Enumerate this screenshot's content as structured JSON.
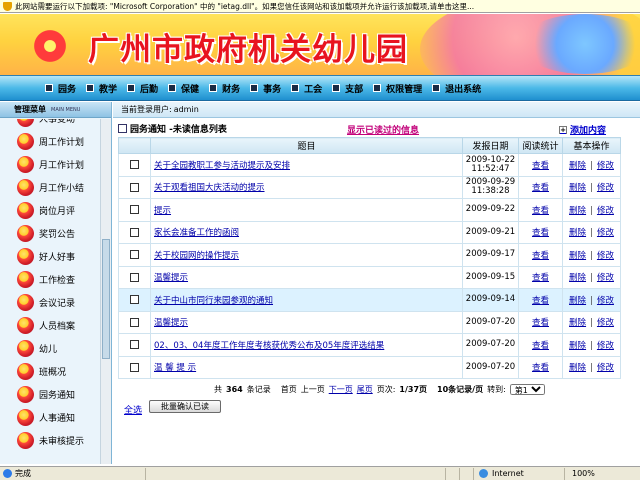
{
  "infobar": {
    "text": "此网站需要运行以下加载项: \"Microsoft Corporation\" 中的 \"ietag.dll\"。如果您信任该网站和该加载项并允许运行该加载项,请单击这里..."
  },
  "banner": {
    "title": "广州市政府机关幼儿园"
  },
  "nav": {
    "items": [
      {
        "label": "园务"
      },
      {
        "label": "教学"
      },
      {
        "label": "后勤"
      },
      {
        "label": "保健"
      },
      {
        "label": "财务"
      },
      {
        "label": "事务"
      },
      {
        "label": "工会"
      },
      {
        "label": "支部"
      },
      {
        "label": "权限管理"
      },
      {
        "label": "退出系统"
      }
    ]
  },
  "sidebar": {
    "heading": "管理菜单",
    "heading_en": "MAIN MENU",
    "items": [
      {
        "label": "人事变动"
      },
      {
        "label": "周工作计划"
      },
      {
        "label": "月工作计划"
      },
      {
        "label": "月工作小结"
      },
      {
        "label": "岗位月评"
      },
      {
        "label": "奖罚公告"
      },
      {
        "label": "好人好事"
      },
      {
        "label": "工作检查"
      },
      {
        "label": "会议记录"
      },
      {
        "label": "人员档案"
      },
      {
        "label": "幼儿"
      },
      {
        "label": "班概况"
      },
      {
        "label": "园务通知"
      },
      {
        "label": "人事通知"
      },
      {
        "label": "未审核提示"
      }
    ]
  },
  "userbar": {
    "label": "当前登录用户:",
    "user": "admin"
  },
  "panel": {
    "title": "园务通知 -未读信息列表",
    "show_read": "显示已读过的信息",
    "add": "添加内容"
  },
  "table": {
    "headers": [
      "",
      "题目",
      "发报日期",
      "阅读统计",
      "基本操作"
    ],
    "view_label": "查看",
    "delete_label": "删除",
    "edit_label": "修改",
    "op_sep": "|",
    "rows": [
      {
        "title": "关于全园教职工参与活动提示及安排",
        "date": "2009-10-22",
        "time": "11:52:47"
      },
      {
        "title": "关于观看祖国大庆活动的提示",
        "date": "2009-09-29",
        "time": "11:38:28"
      },
      {
        "title": "提示",
        "date": "2009-09-22",
        "time": ""
      },
      {
        "title": "家长会准备工作的函阅",
        "date": "2009-09-21",
        "time": ""
      },
      {
        "title": "关于校园网的操作提示",
        "date": "2009-09-17",
        "time": ""
      },
      {
        "title": "温馨提示",
        "date": "2009-09-15",
        "time": ""
      },
      {
        "title": "关于中山市同行来园参观的通知",
        "date": "2009-09-14",
        "time": ""
      },
      {
        "title": "温馨提示",
        "date": "2009-07-20",
        "time": ""
      },
      {
        "title": "02、03、04年度工作年度考核获优秀公布及05年度评选结果",
        "date": "2009-07-20",
        "time": ""
      },
      {
        "title": "温 馨 提 示",
        "date": "2009-07-20",
        "time": ""
      }
    ]
  },
  "pager": {
    "total_prefix": "共",
    "total": "364",
    "total_suffix": "条记录",
    "first": "首页",
    "prev": "上一页",
    "next": "下一页",
    "last": "尾页",
    "page_prefix": "页次:",
    "page": "1/37页",
    "per_page": "10条记录/页",
    "goto": "转到:",
    "goto_value": "第1页"
  },
  "footer": {
    "select_all": "全选",
    "confirm_read": "批量确认已读"
  },
  "statusbar": {
    "done": "完成",
    "zone": "Internet",
    "zoom": "100%"
  }
}
